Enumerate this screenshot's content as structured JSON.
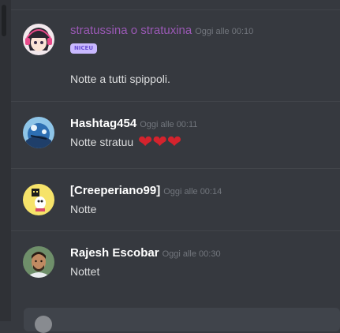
{
  "messages": [
    {
      "author": "stratussina o stratuxina",
      "timestamp": "Oggi alle 00:10",
      "sticker_text": "NICEU",
      "text": "Notte a tutti spippoli.",
      "author_color": "#9b59b6",
      "avatar": "anime-girl-headphones-avatar"
    },
    {
      "author": "Hashtag454",
      "timestamp": "Oggi alle 00:11",
      "text": "Notte stratuu",
      "hearts": [
        "❤",
        "❤",
        "❤"
      ],
      "avatar": "blue-artwork-avatar"
    },
    {
      "author": "[Creeperiano99]",
      "timestamp": "Oggi alle 00:14",
      "text": "Notte",
      "avatar": "yellow-cartoon-avatar"
    },
    {
      "author": "Rajesh Escobar",
      "timestamp": "Oggi alle 00:30",
      "text": "Nottet",
      "avatar": "man-photo-avatar"
    }
  ],
  "colors": {
    "background": "#36393f",
    "heart": "#d4232d",
    "timestamp": "#72767d"
  }
}
